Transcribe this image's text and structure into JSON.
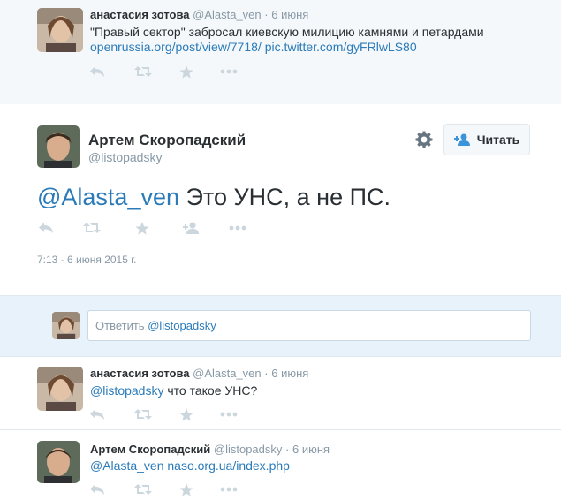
{
  "tweets": [
    {
      "author_name": "анастасия зотова",
      "author_handle": "@Alasta_ven",
      "time": "6 июня",
      "text_line1": "\"Правый сектор\" забросал киевскую милицию камнями и петардами",
      "link1": "openrussia.org/post/view/7718/",
      "link2": "pic.twitter.com/gyFRlwLS80"
    },
    {
      "author_name": "анастасия зотова",
      "author_handle": "@Alasta_ven",
      "time": "6 июня",
      "mention": "@listopadsky",
      "text": " что такое УНС?"
    },
    {
      "author_name": "Артем Скоропадский",
      "author_handle": "@listopadsky",
      "time": "6 июня",
      "mention": "@Alasta_ven",
      "link": "naso.org.ua/index.php"
    }
  ],
  "main_tweet": {
    "author_name": "Артем Скоропадский",
    "author_handle": "@listopadsky",
    "mention": "@Alasta_ven",
    "text": " Это УНС, а не ПС.",
    "timestamp": "7:13 - 6 июня 2015 г.",
    "follow_label": "Читать"
  },
  "reply_box": {
    "placeholder_prefix": "Ответить ",
    "placeholder_mention": "@listopadsky"
  },
  "separator_dot": "·",
  "icons": {
    "reply": "reply-icon",
    "retweet": "retweet-icon",
    "favorite": "star-icon",
    "more": "more-icon",
    "follow": "follow-user-icon",
    "settings": "gear-icon"
  },
  "colors": {
    "link": "#2b7bb9",
    "icon": "#ccd6dd",
    "secondary_text": "#8899a6",
    "background": "#f5f8fa"
  }
}
